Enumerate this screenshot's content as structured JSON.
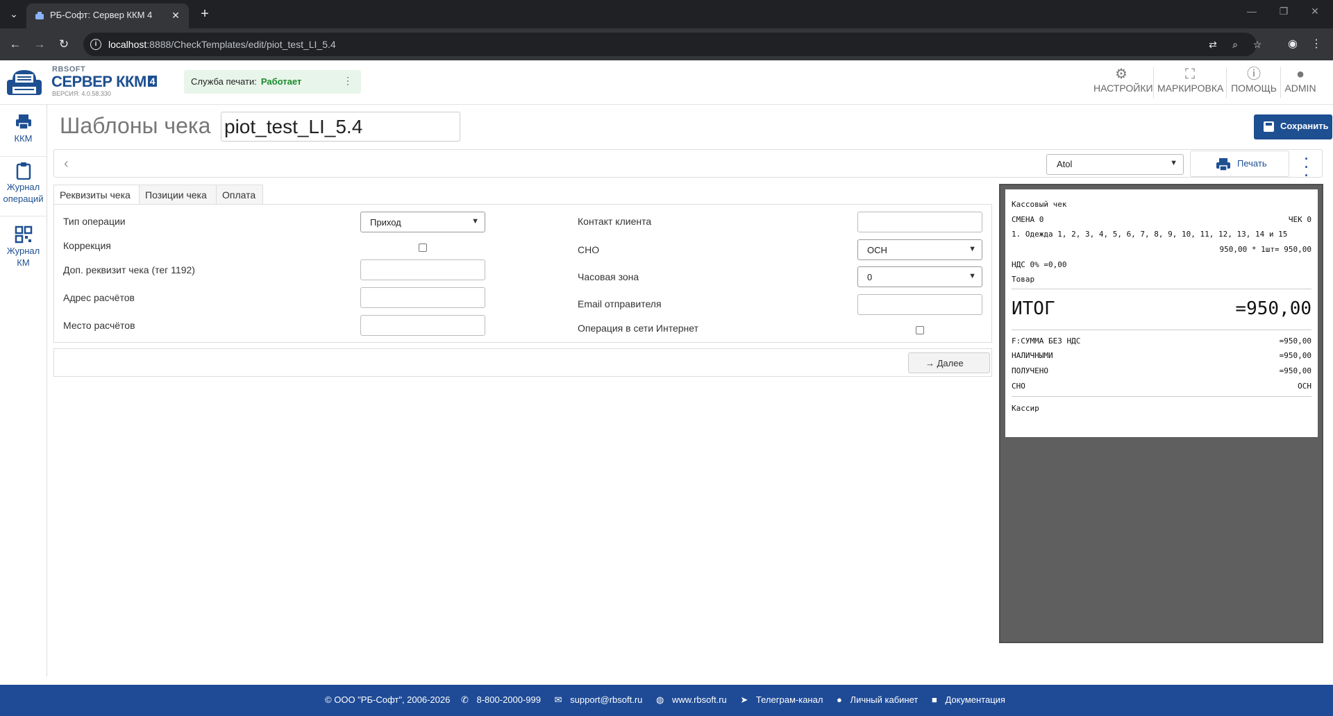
{
  "browser": {
    "tab_title": "РБ-Софт: Сервер ККМ 4",
    "url_host": "localhost",
    "url_path": ":8888/CheckTemplates/edit/piot_test_LI_5.4"
  },
  "header": {
    "logo_rb": "RBSOFT",
    "logo_name": "СЕРВЕР ККМ",
    "logo_badge": "4",
    "logo_version": "ВЕРСИЯ: 4.0.58.330",
    "print_service_label": "Служба печати:",
    "print_service_status": "Работает",
    "buttons": {
      "settings": "НАСТРОЙКИ",
      "marking": "МАРКИРОВКА",
      "help": "ПОМОЩЬ",
      "admin": "ADMIN"
    }
  },
  "sidebar": {
    "kkm": "ККМ",
    "ops_journal_1": "Журнал",
    "ops_journal_2": "операций",
    "km_journal_1": "Журнал",
    "km_journal_2": "КМ"
  },
  "main": {
    "title": "Шаблоны чека",
    "template_name": "piot_test_LI_5.4",
    "save_label": "Сохранить",
    "printer": "Atol",
    "print_label": "Печать",
    "tabs": [
      "Реквизиты чека",
      "Позиции чека",
      "Оплата"
    ],
    "next_label": "Далее"
  },
  "form": {
    "op_type_label": "Тип операции",
    "op_type_value": "Приход",
    "correction_label": "Коррекция",
    "extra_req_label": "Доп. реквизит чека (тег 1192)",
    "address_label": "Адрес расчётов",
    "place_label": "Место расчётов",
    "client_contact_label": "Контакт клиента",
    "sno_label": "СНО",
    "sno_value": "ОСН",
    "tz_label": "Часовая зона",
    "tz_value": "0",
    "sender_email_label": "Email отправителя",
    "internet_label": "Операция в сети Интернет"
  },
  "receipt": {
    "title": "Кассовый чек",
    "shift": "СМЕНА 0",
    "check": "ЧЕК 0",
    "item": "1. Одежда 1, 2, 3, 4, 5, 6, 7, 8, 9, 10, 11, 12, 13, 14 и 15",
    "item_price": "950,00 * 1шт= 950,00",
    "vat": "НДС 0% =0,00",
    "goods": "Товар",
    "total_label": "ИТОГ",
    "total_value": "=950,00",
    "sum_no_vat_label": "F:СУММА БЕЗ НДС",
    "sum_no_vat_value": "=950,00",
    "cash_label": "НАЛИЧНЫМИ",
    "cash_value": "=950,00",
    "received_label": "ПОЛУЧЕНО",
    "received_value": "=950,00",
    "sno_label": "СНО",
    "sno_value": "ОСН",
    "cashier": "Кассир"
  },
  "footer": {
    "copyright": "© ООО \"РБ-Софт\", 2006-2026",
    "phone": "8-800-2000-999",
    "email": "support@rbsoft.ru",
    "site": "www.rbsoft.ru",
    "telegram": "Телеграм-канал",
    "cabinet": "Личный кабинет",
    "docs": "Документация"
  }
}
